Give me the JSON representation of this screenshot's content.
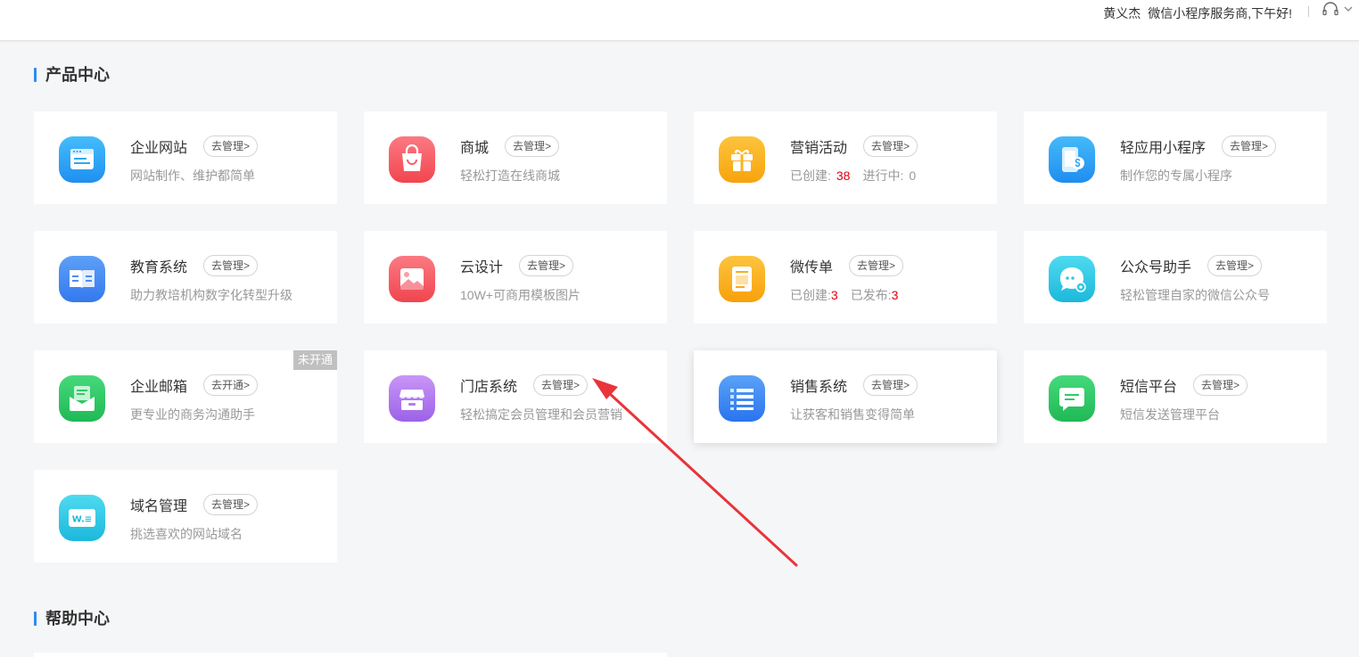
{
  "header": {
    "user_name": "黄义杰",
    "greeting": "微信小程序服务商,下午好!",
    "support_icon": "headset-icon",
    "menu_icon": "chevron-down-icon"
  },
  "sections": {
    "products_title": "产品中心",
    "help_title": "帮助中心"
  },
  "colors": {
    "accent": "#2d8cf0",
    "count_red": "#e0000f",
    "annotation_arrow": "#e8343a"
  },
  "products": [
    {
      "name": "企业网站",
      "action": "去管理>",
      "desc": "网站制作、维护都简单",
      "icon": "website-icon",
      "color": "#2fa7f5"
    },
    {
      "name": "商城",
      "action": "去管理>",
      "desc": "轻松打造在线商城",
      "icon": "shopping-bag-icon",
      "color": "#f8606a"
    },
    {
      "name": "营销活动",
      "action": "去管理>",
      "desc_parts": {
        "created_label": "已创建:",
        "created": "38",
        "running_label": "进行中:",
        "running": "0"
      },
      "icon": "gift-icon",
      "color": "#fbb41c"
    },
    {
      "name": "轻应用小程序",
      "action": "去管理>",
      "desc": "制作您的专属小程序",
      "icon": "mini-program-icon",
      "color": "#2ea3f6"
    },
    {
      "name": "教育系统",
      "action": "去管理>",
      "desc": "助力教培机构数字化转型升级",
      "icon": "book-icon",
      "color": "#4a8df2"
    },
    {
      "name": "云设计",
      "action": "去管理>",
      "desc": "10W+可商用模板图片",
      "icon": "image-icon",
      "color": "#f5616a"
    },
    {
      "name": "微传单",
      "action": "去管理>",
      "desc_parts": {
        "created_label": "已创建:",
        "created": "3",
        "published_label": "已发布:",
        "published": "3"
      },
      "icon": "flyer-icon",
      "color": "#fbac17"
    },
    {
      "name": "公众号助手",
      "action": "去管理>",
      "desc": "轻松管理自家的微信公众号",
      "icon": "chat-gear-icon",
      "color": "#2fcbe6"
    },
    {
      "name": "企业邮箱",
      "action": "去开通>",
      "desc": "更专业的商务沟通助手",
      "badge": "未开通",
      "icon": "mail-icon",
      "color": "#2ecb68"
    },
    {
      "name": "门店系统",
      "action": "去管理>",
      "desc": "轻松搞定会员管理和会员营销",
      "icon": "store-icon",
      "color": "#b57cf0"
    },
    {
      "name": "销售系统",
      "action": "去管理>",
      "desc": "让获客和销售变得简单",
      "icon": "list-icon",
      "color": "#3c8cf3"
    },
    {
      "name": "短信平台",
      "action": "去管理>",
      "desc": "短信发送管理平台",
      "icon": "message-icon",
      "color": "#2ecb68"
    },
    {
      "name": "域名管理",
      "action": "去管理>",
      "desc": "挑选喜欢的网站域名",
      "icon": "domain-icon",
      "color": "#2fcbe6"
    }
  ]
}
